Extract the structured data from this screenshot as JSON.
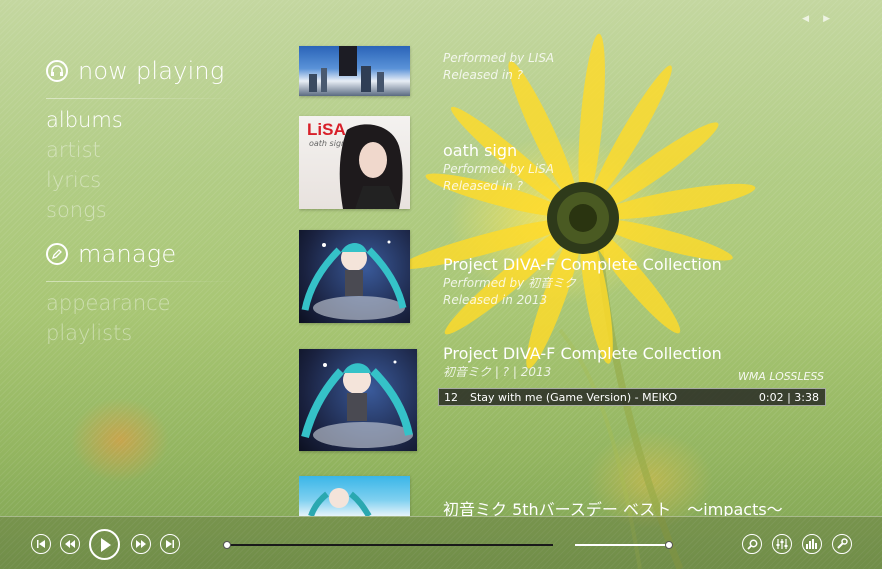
{
  "sidebar": {
    "now_playing": {
      "title": "now playing",
      "items": [
        {
          "label": "albums",
          "active": true
        },
        {
          "label": "artist",
          "active": false
        },
        {
          "label": "lyrics",
          "active": false
        },
        {
          "label": "songs",
          "active": false
        }
      ]
    },
    "manage": {
      "title": "manage",
      "items": [
        {
          "label": "appearance",
          "active": false
        },
        {
          "label": "playlists",
          "active": false
        }
      ]
    }
  },
  "albums": [
    {
      "title": "",
      "artist": "Performed by LISA",
      "released": "Released in ?"
    },
    {
      "title": "oath sign",
      "artist": "Performed by LiSA",
      "released": "Released in ?"
    },
    {
      "title": "Project DIVA-F Complete Collection",
      "artist": "Performed by 初音ミク",
      "released": "Released in 2013"
    },
    {
      "title": "Project DIVA-F Complete Collection",
      "sub": "初音ミク | ? | 2013",
      "format": "WMA LOSSLESS",
      "now_playing": {
        "track_no": "12",
        "track": "Stay with me (Game Version) - MEIKO",
        "time": "0:02  |  3:38"
      }
    },
    {
      "title": "初音ミク 5thバースデー ベスト　～impacts～"
    }
  ],
  "covers": {
    "lisa_logo": "LiSA",
    "lisa_album": "oath sign"
  },
  "player": {
    "progress": 0.0,
    "volume": 1.0
  },
  "colors": {
    "accent": "#ffffff",
    "bar": "#1e1e1e"
  }
}
